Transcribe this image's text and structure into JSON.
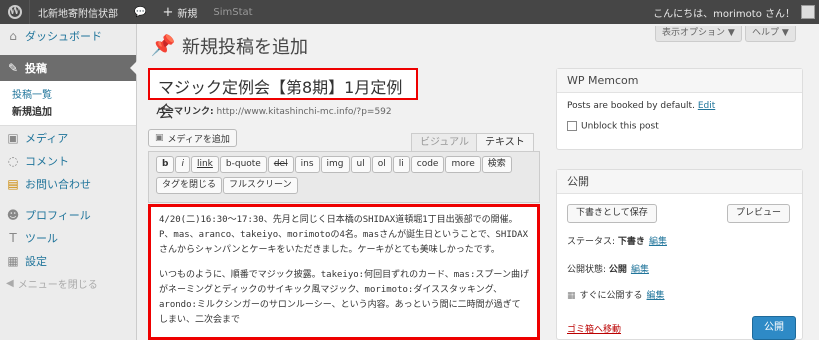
{
  "adminbar": {
    "site": "北新地寄附信状部",
    "new": "新規",
    "plugin": "SimStat",
    "greeting": "こんにちは、morimoto さん！"
  },
  "sidebar": {
    "dashboard": "ダッシュボード",
    "posts": "投稿",
    "post_list": "投稿一覧",
    "post_new": "新規追加",
    "media": "メディア",
    "comments": "コメント",
    "contact": "お問い合わせ",
    "profile": "プロフィール",
    "tools": "ツール",
    "settings": "設定",
    "collapse": "メニューを閉じる"
  },
  "screen_options": {
    "display": "表示オプション ▼",
    "help": "ヘルプ ▼"
  },
  "page": {
    "title": "新規投稿を追加"
  },
  "post": {
    "title": "マジック定例会【第8期】1月定例会",
    "permalink_label": "パーマリンク:",
    "permalink_url": "http://www.kitashinchi-mc.info/?p=592"
  },
  "editor": {
    "add_media": "メディアを追加",
    "tab_visual": "ビジュアル",
    "tab_text": "テキスト",
    "buttons": [
      "b",
      "i",
      "link",
      "b-quote",
      "del",
      "ins",
      "img",
      "ul",
      "ol",
      "li",
      "code",
      "more",
      "検索",
      "タグを閉じる",
      "フルスクリーン"
    ],
    "content": [
      "4/20(二)16:30～17:30、先月と同じく日本橋のSHIDAX道頓堀1丁目出張部での開催。P、mas、aranco、takeiyo、morimotoの4名。masさんが誕生日ということで、SHIDAXさんからシャンパンとケーキをいただきました。ケーキがとても美味しかったです。",
      "いつものように、順番でマジック披露。takeiyo:何回目ずれのカード、mas:スプーン曲げがネーミングとディックのサイキック風マジック、morimoto:ダイススタッキング、arondo:ミルクシンガーのサロンルーシー、という内容。あっという間に二時間が過ぎてしまい、二次会まで"
    ]
  },
  "wp_box": {
    "title": "WP Memcom",
    "text": "Posts are booked by default.",
    "edit": "Edit",
    "unblock": "Unblock this post"
  },
  "publish": {
    "title": "公開",
    "save_draft": "下書きとして保存",
    "preview": "プレビュー",
    "status_label": "ステータス:",
    "status_value": "下書き",
    "status_edit": "編集",
    "visibility_label": "公開状態:",
    "visibility_value": "公開",
    "visibility_edit": "編集",
    "schedule_label": "すぐに公開する",
    "schedule_edit": "編集",
    "trash": "ゴミ箱へ移動",
    "publish": "公開"
  }
}
